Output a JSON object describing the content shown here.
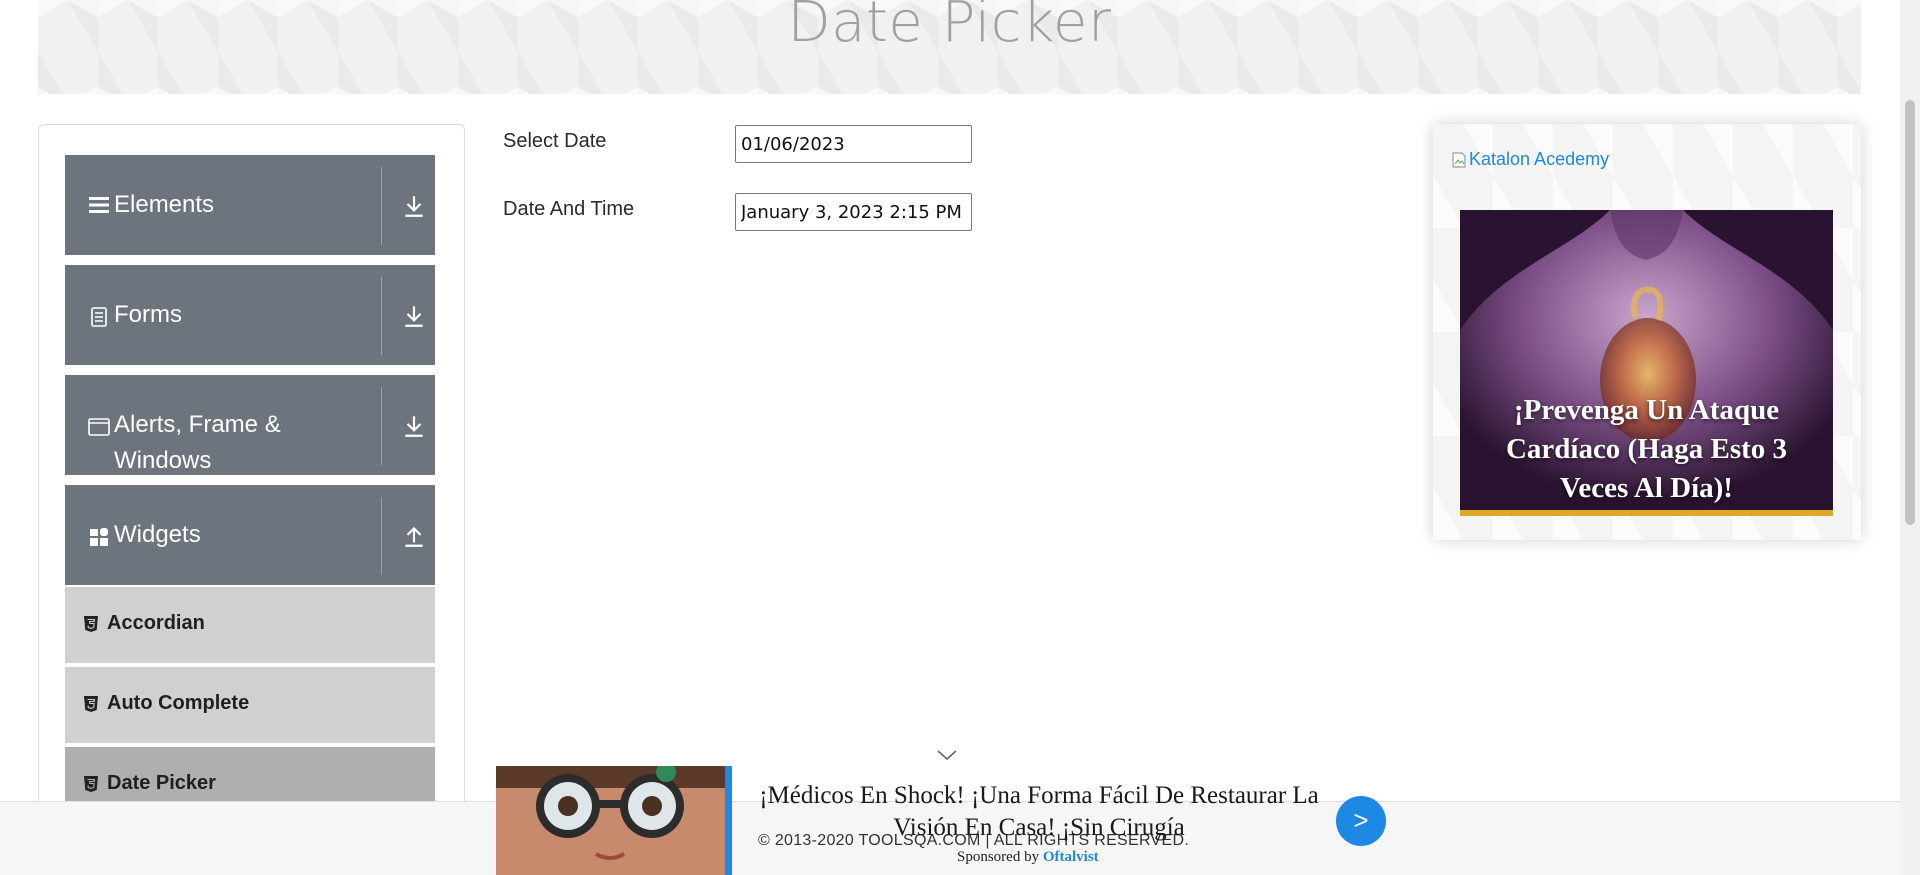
{
  "header": {
    "title": "Date Picker"
  },
  "sidebar": {
    "groups": [
      {
        "label": "Elements",
        "icon": "hamburger-icon",
        "arrow": "download-icon"
      },
      {
        "label": "Forms",
        "icon": "document-icon",
        "arrow": "download-icon"
      },
      {
        "label": "Alerts, Frame &",
        "label2": "Windows",
        "icon": "window-icon",
        "arrow": "download-icon"
      },
      {
        "label": "Widgets",
        "icon": "grid-icon",
        "arrow": "upload-icon"
      }
    ],
    "items": [
      {
        "label": "Accordian",
        "icon": "html5-icon"
      },
      {
        "label": "Auto Complete",
        "icon": "html5-icon"
      },
      {
        "label": "Date Picker",
        "icon": "html5-icon",
        "active": true
      }
    ]
  },
  "form": {
    "select_date_label": "Select Date",
    "select_date_value": "01/06/2023",
    "date_time_label": "Date And Time",
    "date_time_value": "January 3, 2023 2:15 PM"
  },
  "side_ad": {
    "broken_image_alt": "Katalon Acedemy",
    "headline": "¡Prevenga Un Ataque Cardíaco (Haga Esto 3 Veces Al Día)!"
  },
  "bottom_ad": {
    "headline": "¡Médicos En Shock! ¡Una Forma Fácil De Restaurar La Visión En Casa! ¡Sin Cirugía",
    "button": ">",
    "sponsored_by": "Sponsored by",
    "sponsor_name": "Oftalvist"
  },
  "footer": {
    "text": "© 2013-2020 TOOLSQA.COM | ALL RIGHTS RESERVED."
  },
  "colors": {
    "sidebar_group_bg": "#6c757d",
    "menu_item_bg": "#d0d0d0",
    "menu_item_active_bg": "#afafaf",
    "link_blue": "#1e88e5"
  }
}
